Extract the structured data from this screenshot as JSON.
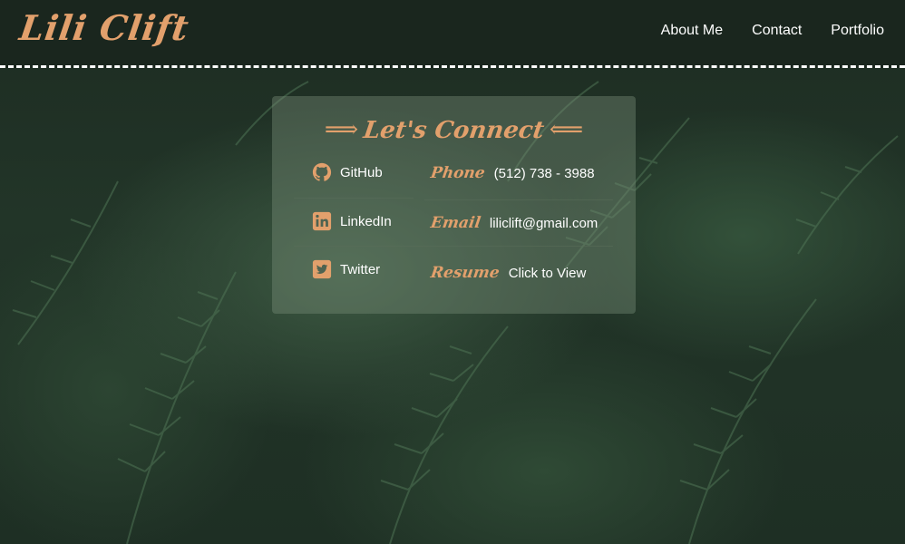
{
  "header": {
    "logo_text": "Lili Clift",
    "nav": [
      {
        "label": "About Me"
      },
      {
        "label": "Contact"
      },
      {
        "label": "Portfolio"
      }
    ]
  },
  "contact_card": {
    "title": "Let's Connect",
    "left_arrow": "⟹",
    "right_arrow": "⟸",
    "social": [
      {
        "label": "GitHub",
        "icon": "github-icon"
      },
      {
        "label": "LinkedIn",
        "icon": "linkedin-icon"
      },
      {
        "label": "Twitter",
        "icon": "twitter-icon"
      }
    ],
    "info": [
      {
        "label": "Phone",
        "value": "(512) 738 - 3988"
      },
      {
        "label": "Email",
        "value": "liliclift@gmail.com"
      },
      {
        "label": "Resume",
        "value": "Click to View"
      }
    ]
  },
  "colors": {
    "accent": "#e2a06c",
    "header_bg": "#1a261e",
    "text": "#ffffff"
  }
}
